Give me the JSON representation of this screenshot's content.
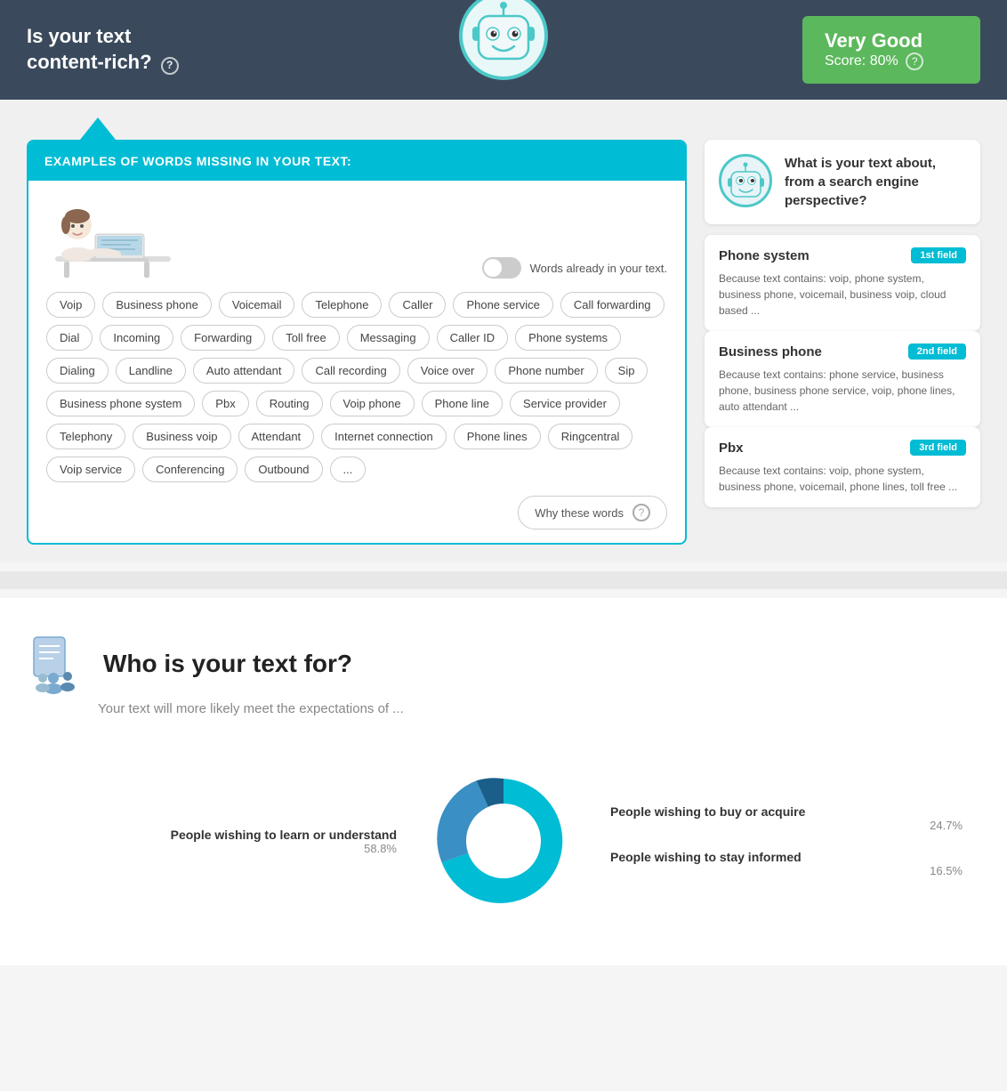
{
  "header": {
    "question": "Is your text\ncontent-rich?",
    "question_mark_label": "?",
    "score_label": "Very Good",
    "score_value": "Score: 80%",
    "score_mark": "?"
  },
  "missing_words": {
    "panel_title": "EXAMPLES OF WORDS MISSING IN YOUR TEXT:",
    "toggle_label": "Words already in your text.",
    "tags": [
      "Voip",
      "Business phone",
      "Voicemail",
      "Telephone",
      "Caller",
      "Phone service",
      "Call forwarding",
      "Dial",
      "Incoming",
      "Forwarding",
      "Toll free",
      "Messaging",
      "Caller ID",
      "Phone systems",
      "Dialing",
      "Landline",
      "Auto attendant",
      "Call recording",
      "Voice over",
      "Phone number",
      "Sip",
      "Business phone system",
      "Pbx",
      "Routing",
      "Voip phone",
      "Phone line",
      "Service provider",
      "Telephony",
      "Business voip",
      "Attendant",
      "Internet connection",
      "Phone lines",
      "Ringcentral",
      "Voip service",
      "Conferencing",
      "Outbound",
      "..."
    ],
    "why_button": "Why these words",
    "why_button_icon": "?"
  },
  "right_panel": {
    "what_is_title": "What is your text about, from a search engine perspective?",
    "fields": [
      {
        "name": "Phone system",
        "badge": "1st field",
        "description": "Because text contains:  voip, phone system, business phone, voicemail, business voip, cloud based ..."
      },
      {
        "name": "Business phone",
        "badge": "2nd field",
        "description": "Because text contains:  phone service, business phone, business phone service, voip, phone lines, auto attendant ..."
      },
      {
        "name": "Pbx",
        "badge": "3rd field",
        "description": "Because text contains:  voip, phone system, business phone, voicemail, phone lines, toll free ..."
      }
    ]
  },
  "who_section": {
    "title": "Who is your text for?",
    "subtitle": "Your text will more likely meet the expectations of ...",
    "chart": {
      "segments": [
        {
          "label": "People wishing to learn or understand",
          "pct": "58.8%",
          "pct_num": 58.8,
          "color": "#00bcd4",
          "side": "left"
        },
        {
          "label": "People wishing to buy or acquire",
          "pct": "24.7%",
          "pct_num": 24.7,
          "color": "#3a8fc4",
          "side": "right"
        },
        {
          "label": "People wishing to stay informed",
          "pct": "16.5%",
          "pct_num": 16.5,
          "color": "#1a5f8a",
          "side": "right"
        }
      ]
    }
  }
}
